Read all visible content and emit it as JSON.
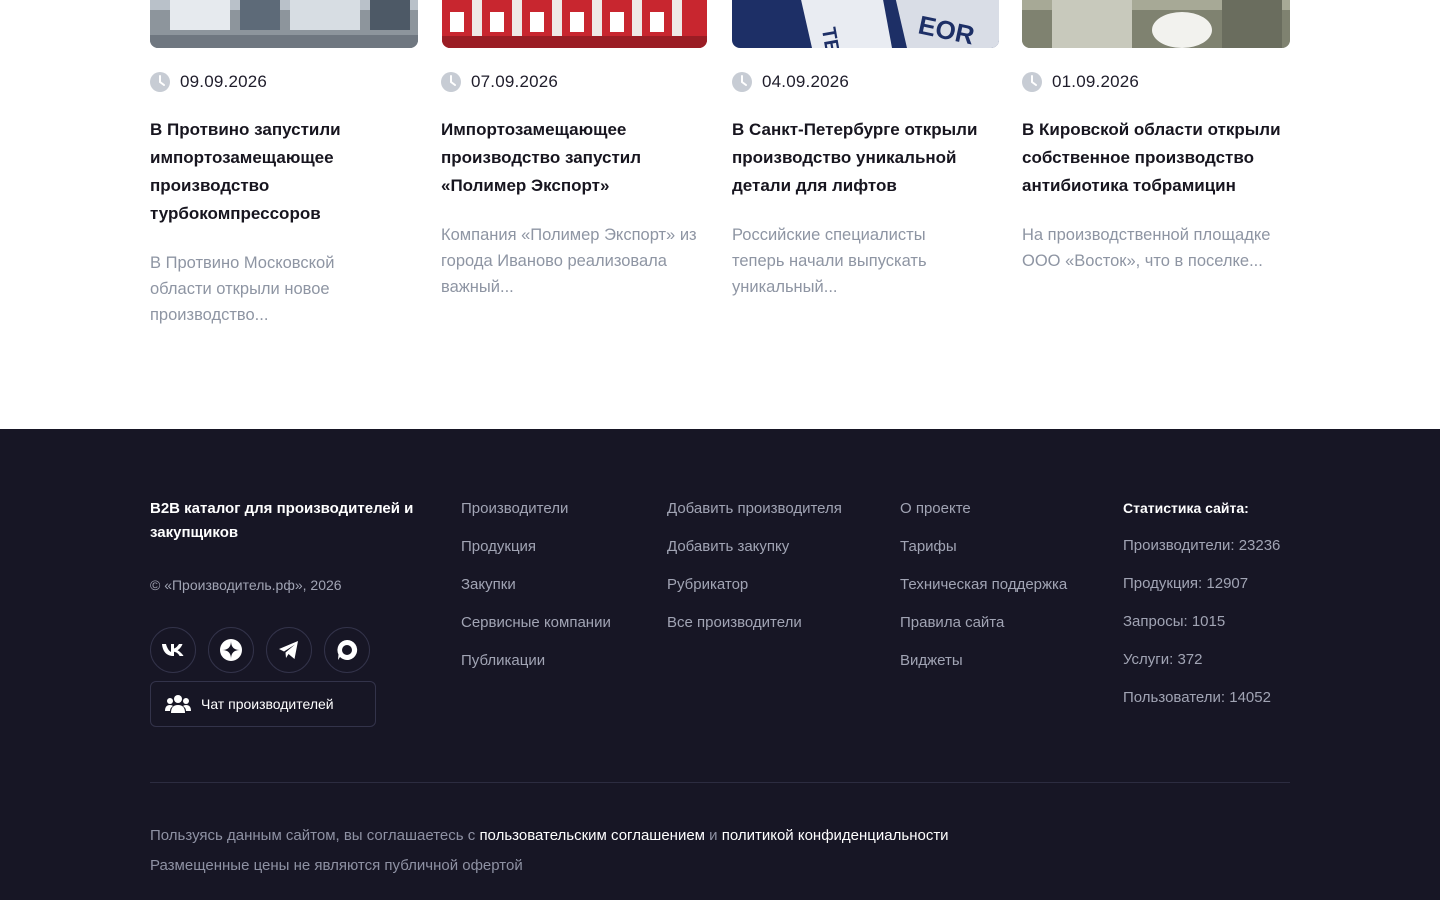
{
  "news": [
    {
      "date": "09.09.2026",
      "title": "В Протвино запустили импортозамещающее производство турбокомпрессоров",
      "excerpt": "В Протвино Московской области открыли новое производство...",
      "image": "factory-workshop-photo",
      "accent": "#c9d0d8"
    },
    {
      "date": "07.09.2026",
      "title": "Импортозамещающее производство запустил «Полимер Экспорт»",
      "excerpt": "Компания «Полимер Экспорт» из города Иваново реализовала важный...",
      "image": "paint-buckets-photo",
      "accent": "#c8262f"
    },
    {
      "date": "04.09.2026",
      "title": "В Санкт-Петербурге открыли производство уникальной детали для лифтов",
      "excerpt": "Российские специалисты теперь начали выпускать уникальный...",
      "image": "meteor-lift-flags-photo",
      "accent": "#1d2f66"
    },
    {
      "date": "01.09.2026",
      "title": "В Кировской области открыли собственное производство антибиотика тобрамицин",
      "excerpt": "На производственной площадке ООО «Восток», что в поселке...",
      "image": "pharma-cleanroom-photo",
      "accent": "#8a8f7c"
    }
  ],
  "footer": {
    "brand": "B2B каталог для производителей и закупщиков",
    "copyright": "© «Производитель.рф», 2026",
    "socials": [
      "vk-icon",
      "openai-icon",
      "telegram-icon",
      "max-messenger-icon"
    ],
    "chat_label": "Чат производителей",
    "col1": [
      "Производители",
      "Продукция",
      "Закупки",
      "Сервисные компании",
      "Публикации"
    ],
    "col2": [
      "Добавить производителя",
      "Добавить закупку",
      "Рубрикатор",
      "Все производители"
    ],
    "col3": [
      "О проекте",
      "Тарифы",
      "Техническая поддержка",
      "Правила сайта",
      "Виджеты"
    ],
    "stats": {
      "title": "Статистика сайта:",
      "items": [
        {
          "label": "Производители:",
          "value": "23236"
        },
        {
          "label": "Продукция:",
          "value": "12907"
        },
        {
          "label": "Запросы:",
          "value": "1015"
        },
        {
          "label": "Услуги:",
          "value": "372"
        },
        {
          "label": "Пользователи:",
          "value": "14052"
        }
      ]
    },
    "legal": {
      "prefix": "Пользуясь данным сайтом, вы соглашаетесь с",
      "agreement_link": "пользовательским соглашением",
      "and": "и",
      "privacy_link": "политикой конфиденциальности"
    },
    "offer_note": "Размещенные цены не являются публичной офертой"
  }
}
